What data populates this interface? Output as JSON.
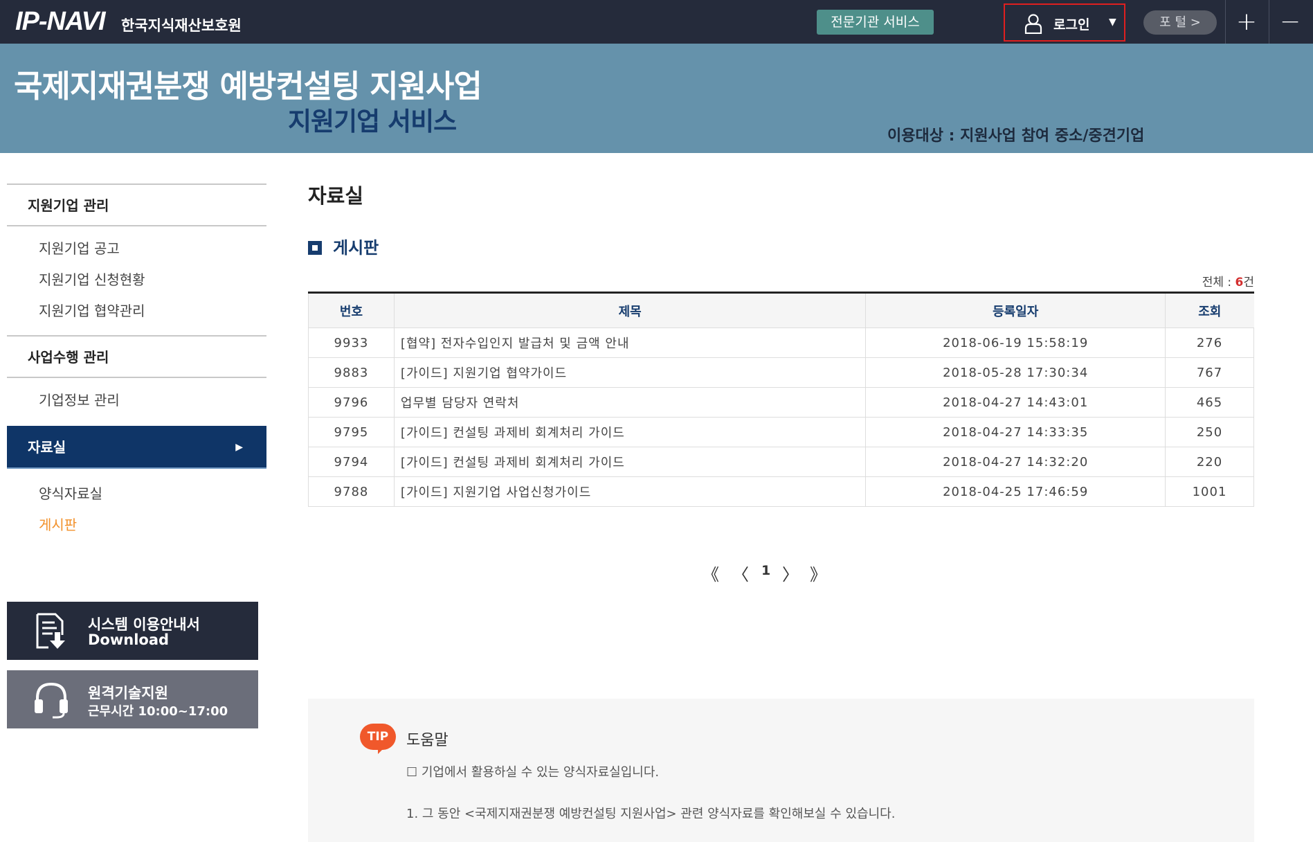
{
  "header": {
    "logo": "IP-NAVI",
    "logo_sub": "한국지식재산보호원",
    "expert_service": "전문기관 서비스",
    "login": "로그인",
    "portal": "포 털 >",
    "plus": "+",
    "minus": "−"
  },
  "banner": {
    "title": "국제지재권분쟁 예방컨설팅 지원사업",
    "subtitle": "지원기업 서비스",
    "target": "이용대상 : 지원사업 참여 중소/중견기업"
  },
  "sidebar": {
    "group1": "지원기업 관리",
    "group1_items": [
      "지원기업 공고",
      "지원기업 신청현황",
      "지원기업 협약관리"
    ],
    "group2": "사업수행 관리",
    "group2_items": [
      "기업정보 관리"
    ],
    "group3": "자료실",
    "group3_items": [
      "양식자료실",
      "게시판"
    ]
  },
  "promo": {
    "manual_line1": "시스템 이용안내서",
    "manual_line2": "Download",
    "remote_line1": "원격기술지원",
    "remote_line2": "근무시간 10:00~17:00"
  },
  "main": {
    "page_title": "자료실",
    "section_title": "게시판",
    "total_label": "전체 : ",
    "total_count": "6",
    "total_unit": "건",
    "columns": [
      "번호",
      "제목",
      "등록일자",
      "조회"
    ],
    "rows": [
      {
        "no": "9933",
        "title": "[협약] 전자수입인지 발급처 및 금액 안내",
        "date": "2018-06-19 15:58:19",
        "views": "276"
      },
      {
        "no": "9883",
        "title": "[가이드] 지원기업 협약가이드",
        "date": "2018-05-28 17:30:34",
        "views": "767"
      },
      {
        "no": "9796",
        "title": "업무별 담당자 연락처",
        "date": "2018-04-27 14:43:01",
        "views": "465"
      },
      {
        "no": "9795",
        "title": "[가이드] 컨설팅 과제비 회계처리 가이드",
        "date": "2018-04-27 14:33:35",
        "views": "250"
      },
      {
        "no": "9794",
        "title": "[가이드] 컨설팅 과제비 회계처리 가이드",
        "date": "2018-04-27 14:32:20",
        "views": "220"
      },
      {
        "no": "9788",
        "title": "[가이드] 지원기업 사업신청가이드",
        "date": "2018-04-25 17:46:59",
        "views": "1001"
      }
    ],
    "pager": {
      "first": "《",
      "prev": "〈",
      "page": "1",
      "next": "〉",
      "last": "》"
    }
  },
  "tip": {
    "badge": "TIP",
    "title": "도움말",
    "line1": "☐ 기업에서 활용하실 수 있는 양식자료실입니다.",
    "line2": "1. 그 동안 <국제지재권분쟁 예방컨설팅 지원사업> 관련 양식자료를 확인해보실 수 있습니다."
  }
}
